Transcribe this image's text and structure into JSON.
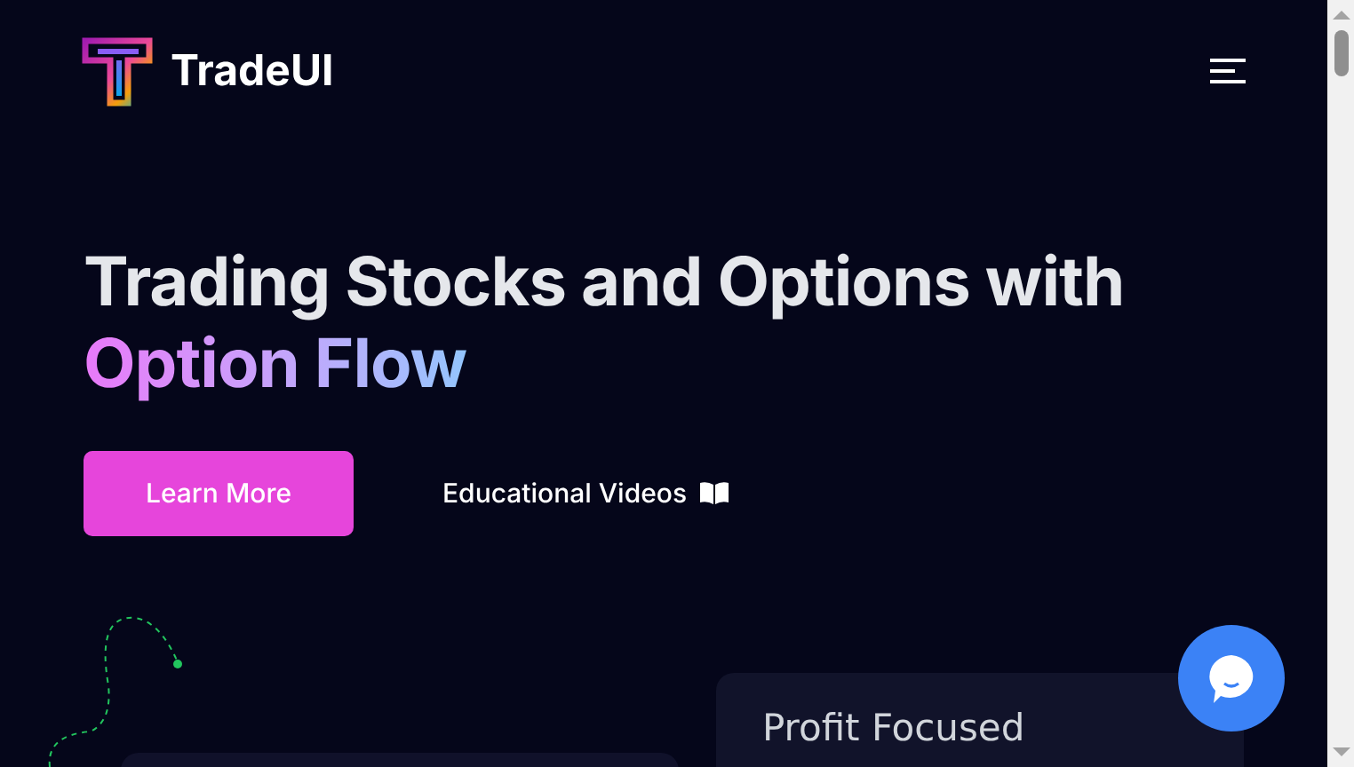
{
  "header": {
    "brand": "TradeUI"
  },
  "hero": {
    "title_line_1": "Trading Stocks and Options with",
    "title_line_2": "Option Flow",
    "primary_button": "Learn More",
    "secondary_link": "Educational Videos"
  },
  "cards": [
    {
      "title": "Profit Focused"
    }
  ]
}
